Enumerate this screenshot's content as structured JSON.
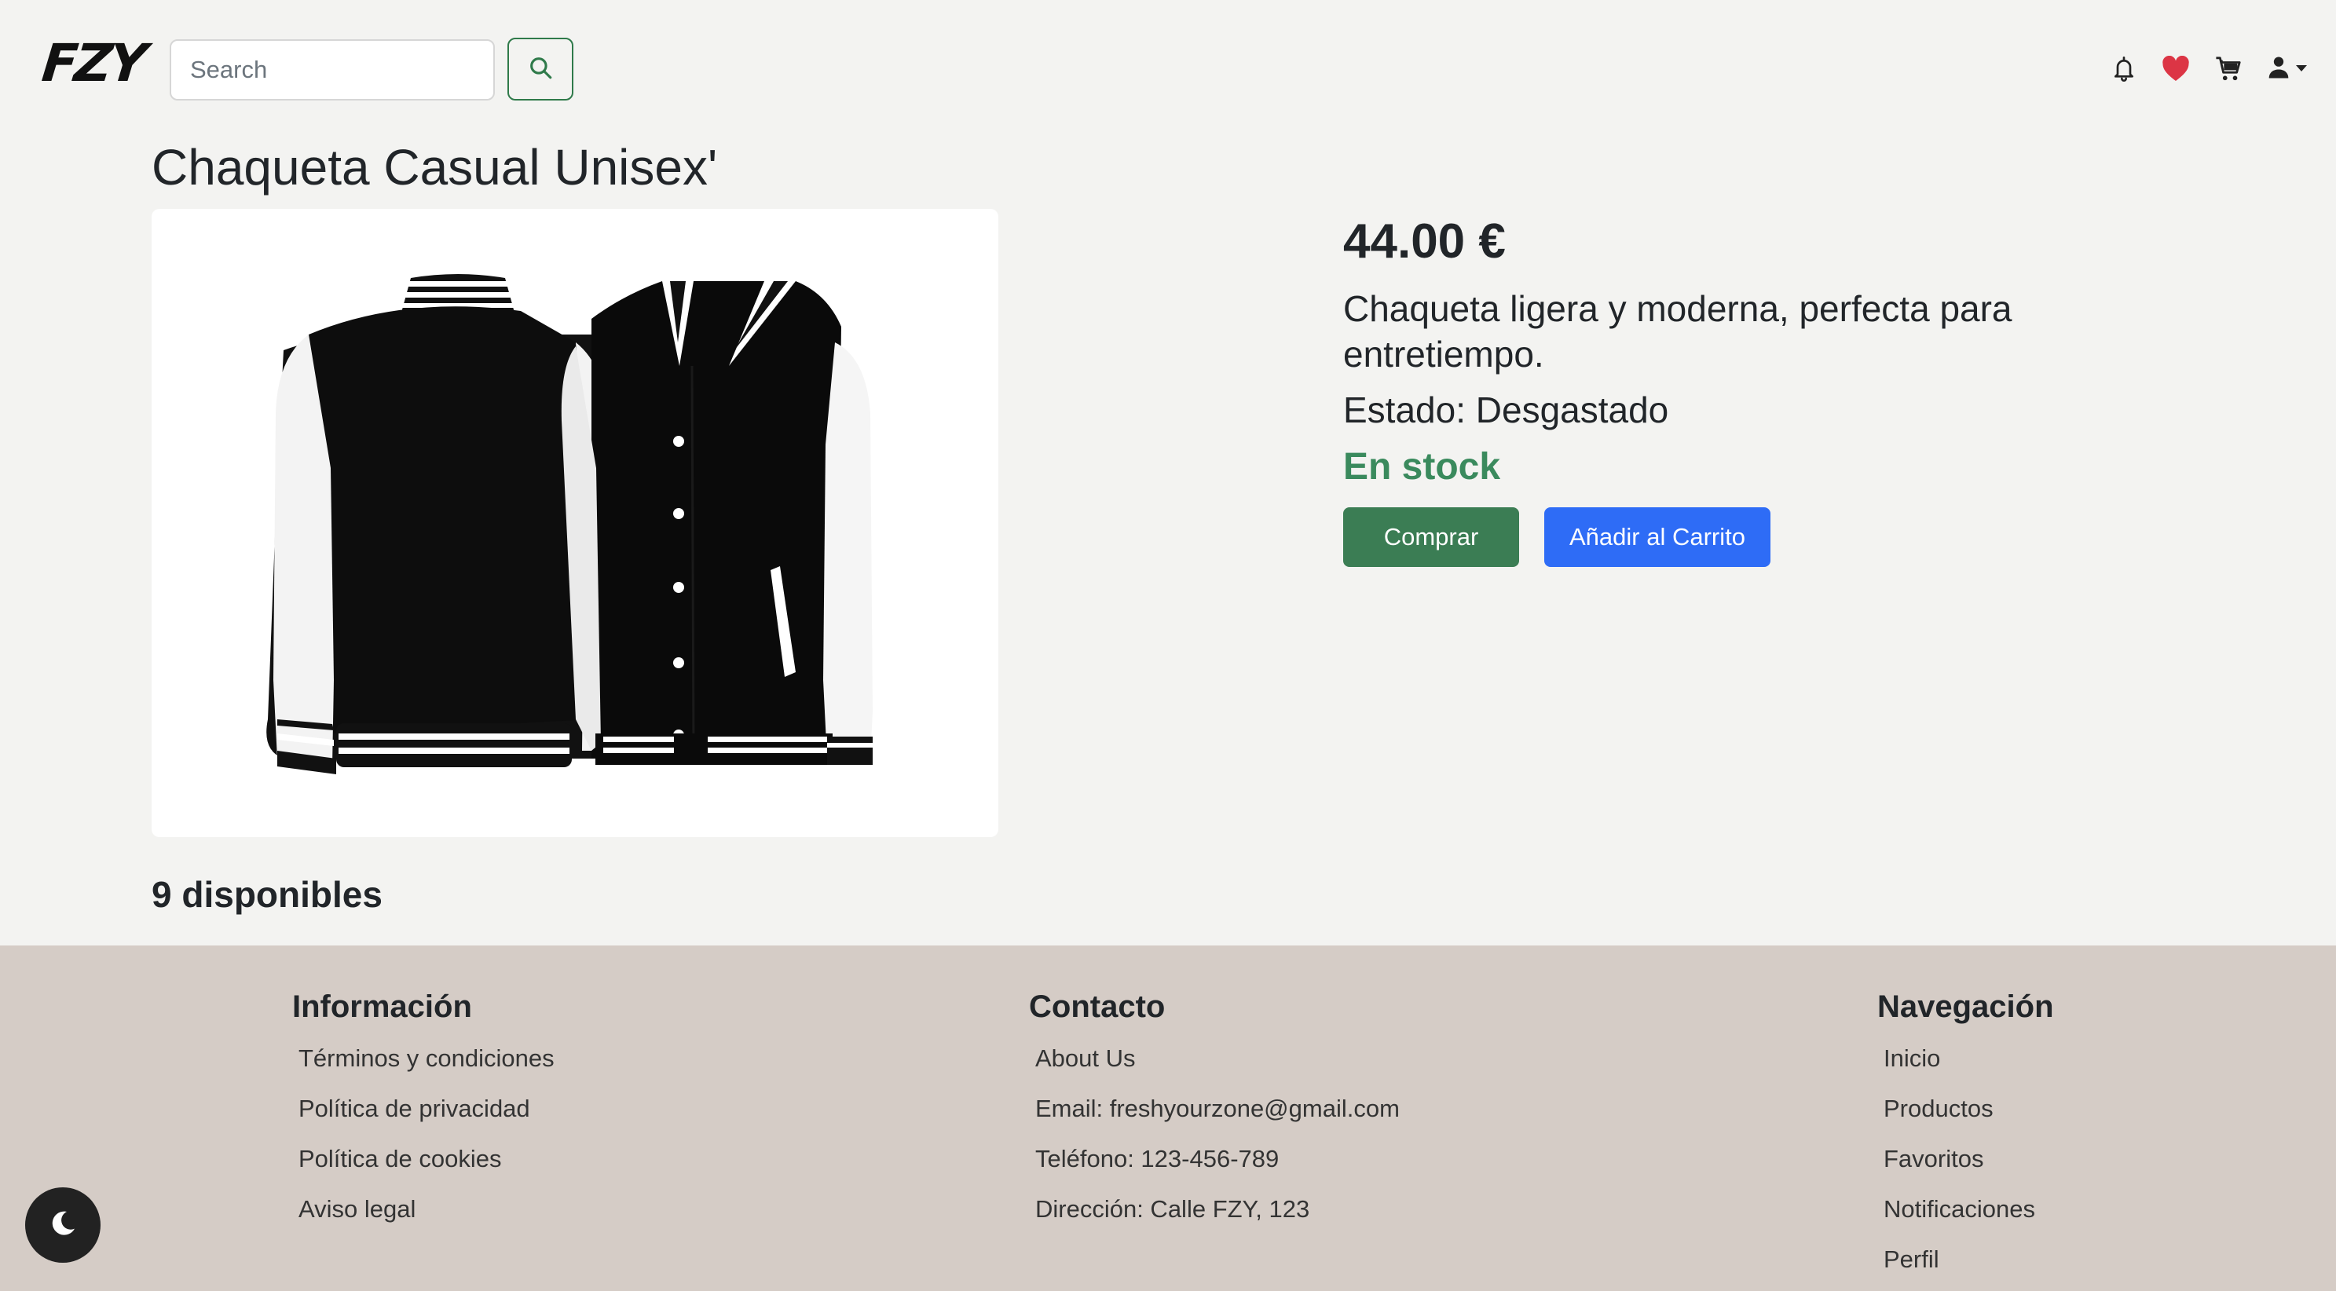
{
  "header": {
    "logo": "FZY",
    "search_placeholder": "Search"
  },
  "product": {
    "title": "Chaqueta Casual Unisex'",
    "price": "44.00 €",
    "description": "Chaqueta ligera y moderna, perfecta para entretiempo.",
    "condition": "Estado: Desgastado",
    "stock_status": "En stock",
    "buy_label": "Comprar",
    "add_to_cart_label": "Añadir al Carrito",
    "available": "9 disponibles"
  },
  "footer": {
    "info": {
      "heading": "Información",
      "links": [
        "Términos y condiciones",
        "Política de privacidad",
        "Política de cookies",
        "Aviso legal"
      ]
    },
    "contact": {
      "heading": "Contacto",
      "links": [
        "About Us",
        "Email: freshyourzone@gmail.com",
        "Teléfono: 123-456-789",
        "Dirección: Calle FZY, 123"
      ]
    },
    "navigation": {
      "heading": "Navegación",
      "links": [
        "Inicio",
        "Productos",
        "Favoritos",
        "Notificaciones",
        "Perfil"
      ]
    }
  },
  "icons": {
    "search": "search-icon",
    "notifications": "bell-icon",
    "favorites": "heart-icon",
    "cart": "cart-icon",
    "user": "user-icon",
    "dark_mode": "moon-icon"
  },
  "colors": {
    "buy_button": "#3b7d54",
    "cart_button": "#2e6cf6",
    "in_stock": "#3a8a5d",
    "favorite_heart": "#dc3545",
    "footer_bg": "#d5ccc6"
  }
}
